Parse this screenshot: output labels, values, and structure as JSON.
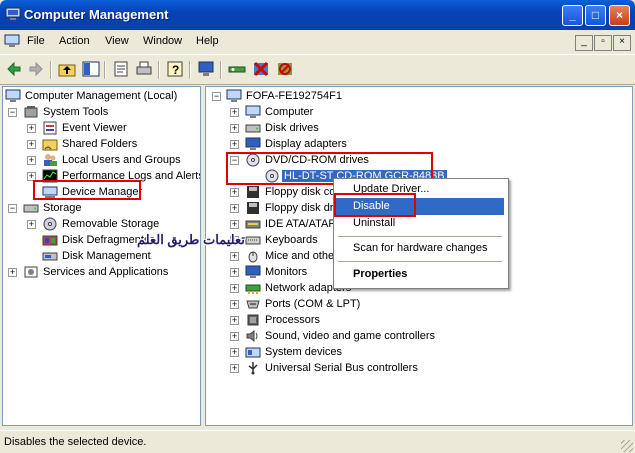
{
  "window": {
    "title": "Computer Management"
  },
  "menu": [
    "File",
    "Action",
    "View",
    "Window",
    "Help"
  ],
  "toolbar_icons": [
    "back-arrow-icon",
    "forward-arrow-icon",
    "up-folder-icon",
    "show-hide-tree-icon",
    "properties-icon",
    "print-icon",
    "help-icon",
    "monitor-icon",
    "scan-hardware-icon",
    "uninstall-icon",
    "disable-icon"
  ],
  "left_tree": [
    {
      "label": "Computer Management (Local)",
      "name": "tree-root"
    },
    {
      "label": "System Tools",
      "name": "tree-system-tools"
    },
    {
      "label": "Event Viewer",
      "name": "tree-event-viewer"
    },
    {
      "label": "Shared Folders",
      "name": "tree-shared-folders"
    },
    {
      "label": "Local Users and Groups",
      "name": "tree-local-users"
    },
    {
      "label": "Performance Logs and Alerts",
      "name": "tree-performance-logs"
    },
    {
      "label": "Device Manager",
      "name": "tree-device-manager"
    },
    {
      "label": "Storage",
      "name": "tree-storage"
    },
    {
      "label": "Removable Storage",
      "name": "tree-removable-storage"
    },
    {
      "label": "Disk Defragmenter",
      "name": "tree-disk-defrag"
    },
    {
      "label": "Disk Management",
      "name": "tree-disk-management"
    },
    {
      "label": "Services and Applications",
      "name": "tree-services-apps"
    }
  ],
  "right_tree": [
    {
      "label": "FOFA-FE192754F1",
      "name": "device-root"
    },
    {
      "label": "Computer",
      "name": "device-computer"
    },
    {
      "label": "Disk drives",
      "name": "device-disk-drives"
    },
    {
      "label": "Display adapters",
      "name": "device-display-adapters"
    },
    {
      "label": "DVD/CD-ROM drives",
      "name": "device-dvd-drives"
    },
    {
      "label": "HL-DT-ST CD-ROM GCR-8483B",
      "name": "device-cdrom-item"
    },
    {
      "label": "Floppy disk cont",
      "name": "device-floppy-controllers"
    },
    {
      "label": "Floppy disk dri",
      "name": "device-floppy-drives"
    },
    {
      "label": "IDE ATA/ATAPI",
      "name": "device-ide"
    },
    {
      "label": "Keyboards",
      "name": "device-keyboards"
    },
    {
      "label": "Mice and othe",
      "name": "device-mice"
    },
    {
      "label": "Monitors",
      "name": "device-monitors"
    },
    {
      "label": "Network adapters",
      "name": "device-network-adapters"
    },
    {
      "label": "Ports (COM & LPT)",
      "name": "device-ports"
    },
    {
      "label": "Processors",
      "name": "device-processors"
    },
    {
      "label": "Sound, video and game controllers",
      "name": "device-sound"
    },
    {
      "label": "System devices",
      "name": "device-system"
    },
    {
      "label": "Universal Serial Bus controllers",
      "name": "device-usb"
    }
  ],
  "context_menu": {
    "update_driver": "Update Driver...",
    "disable": "Disable",
    "uninstall": "Uninstall",
    "scan": "Scan for hardware changes",
    "properties": "Properties"
  },
  "watermark": "تعليمات طريق العلم",
  "status": "Disables the selected device.",
  "colors": {
    "titlebar": "#0842b8",
    "selection": "#316ac5",
    "highlight_box": "#e00000"
  }
}
